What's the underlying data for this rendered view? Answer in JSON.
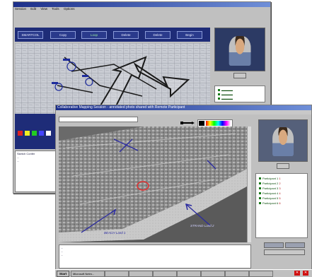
{
  "back_window": {
    "title": "",
    "menu": [
      "Session",
      "Edit",
      "View",
      "Tools",
      "Options"
    ],
    "toolbar_buttons": [
      "SMARTCOL",
      "Copy",
      "Loop",
      "Delete",
      "Delete",
      "Begin"
    ],
    "selected_button_index": 2,
    "notes_lines": [
      "Sketch Confer",
      "...",
      "..."
    ]
  },
  "front_window": {
    "title": "Collaborative Mapping Session - annotated photo shared with Remote Participant",
    "color_palette": [
      "#000000",
      "#ff0000",
      "#ffff00",
      "#00ff00",
      "#00ffff",
      "#0000ff",
      "#ff00ff",
      "#ffffff"
    ],
    "annotations": [
      "BEACH Land 1",
      "STRAND Land 2"
    ],
    "participants": [
      {
        "name": "Participant 1",
        "value": "1"
      },
      {
        "name": "Participant 2",
        "value": "2"
      },
      {
        "name": "Participant 3",
        "value": "3"
      },
      {
        "name": "Participant 4",
        "value": "4"
      },
      {
        "name": "Participant 5",
        "value": "5"
      },
      {
        "name": "Participant 6",
        "value": "6"
      }
    ],
    "notes_lines": [
      "...",
      "...",
      "..."
    ]
  },
  "taskbar": {
    "start_label": "Start",
    "items": [
      "Microsoft Netm...",
      "",
      "",
      "",
      "",
      "",
      "",
      ""
    ]
  },
  "colors": {
    "toolbar": "#2a3a8c",
    "arrow": "#2a2aa0",
    "close": "#d01010"
  }
}
